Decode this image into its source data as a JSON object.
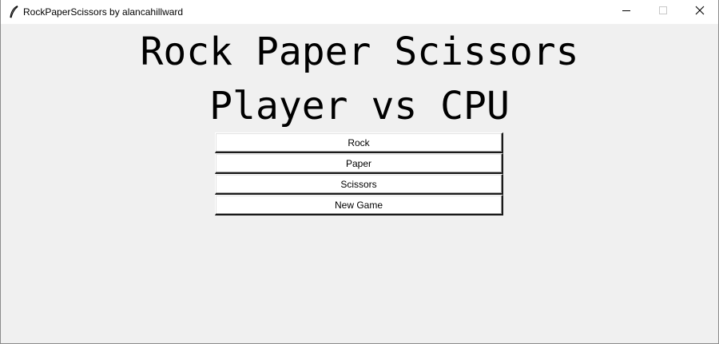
{
  "window": {
    "title": "RockPaperScissors by alancahillward",
    "icons": {
      "app": "feather-icon",
      "minimize": "minimize-icon",
      "maximize": "maximize-icon",
      "close": "close-icon"
    }
  },
  "main": {
    "heading": "Rock Paper Scissors",
    "subheading": "Player vs CPU",
    "buttons": {
      "rock": "Rock",
      "paper": "Paper",
      "scissors": "Scissors",
      "new_game": "New Game"
    }
  },
  "colors": {
    "window_background": "#f0f0f0",
    "titlebar_background": "#ffffff",
    "button_background": "#ffffff",
    "text": "#000000"
  }
}
